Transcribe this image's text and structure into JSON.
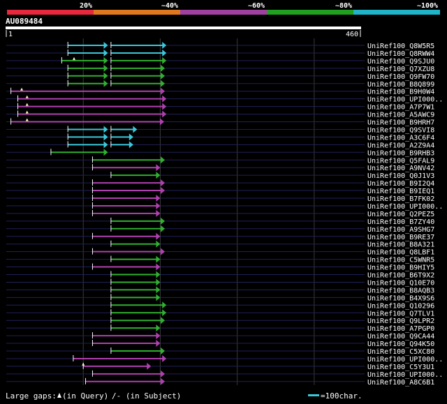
{
  "legend": {
    "labels": [
      "20%",
      "~40%",
      "~60%",
      "~80%",
      "~100%"
    ],
    "colors": [
      "#e8283c",
      "#e07820",
      "#a040a0",
      "#20a020",
      "#20b4c8"
    ]
  },
  "query": {
    "id": "AU089484",
    "start": "1",
    "end": "460",
    "length": 460
  },
  "series_colors": {
    "cyan": "#3cc8dc",
    "green": "#30b030",
    "purple": "#b040b0"
  },
  "hits": [
    {
      "id": "UniRef100_Q8W5R5",
      "color": "cyan",
      "segs": [
        [
          80,
          132
        ],
        [
          136,
          208
        ]
      ]
    },
    {
      "id": "UniRef100_Q8RWW4",
      "color": "cyan",
      "segs": [
        [
          80,
          132
        ],
        [
          136,
          208
        ]
      ]
    },
    {
      "id": "UniRef100_Q9SJU0",
      "color": "green",
      "segs": [
        [
          72,
          132
        ],
        [
          136,
          208
        ]
      ],
      "mark": 88
    },
    {
      "id": "UniRef100_Q7XZU8",
      "color": "green",
      "segs": [
        [
          80,
          132
        ],
        [
          136,
          206
        ]
      ]
    },
    {
      "id": "UniRef100_Q9FW70",
      "color": "green",
      "segs": [
        [
          80,
          132
        ],
        [
          136,
          206
        ]
      ]
    },
    {
      "id": "UniRef100_B8Q899",
      "color": "green",
      "segs": [
        [
          80,
          132
        ],
        [
          136,
          206
        ]
      ]
    },
    {
      "id": "UniRef100_B9H0W4",
      "color": "purple",
      "segs": [
        [
          6,
          206
        ]
      ],
      "mark": 20
    },
    {
      "id": "UniRef100_UPI000..",
      "color": "purple",
      "segs": [
        [
          15,
          208
        ]
      ],
      "mark": 27
    },
    {
      "id": "UniRef100_A7P7W1",
      "color": "purple",
      "segs": [
        [
          15,
          208
        ]
      ],
      "mark": 27
    },
    {
      "id": "UniRef100_A5AWC9",
      "color": "purple",
      "segs": [
        [
          15,
          208
        ]
      ],
      "mark": 27
    },
    {
      "id": "UniRef100_B9HRH7",
      "color": "purple",
      "segs": [
        [
          6,
          205
        ]
      ],
      "mark": 27
    },
    {
      "id": "UniRef100_Q9SVI8",
      "color": "cyan",
      "segs": [
        [
          80,
          132
        ],
        [
          136,
          170
        ]
      ]
    },
    {
      "id": "UniRef100_A3C6F4",
      "color": "cyan",
      "segs": [
        [
          80,
          132
        ],
        [
          136,
          165
        ]
      ]
    },
    {
      "id": "UniRef100_A2Z9A4",
      "color": "cyan",
      "segs": [
        [
          80,
          132
        ],
        [
          136,
          165
        ]
      ]
    },
    {
      "id": "UniRef100_B9RHB3",
      "color": "green",
      "segs": [
        [
          58,
          132
        ]
      ]
    },
    {
      "id": "UniRef100_Q5FAL9",
      "color": "green",
      "segs": [
        [
          112,
          206
        ]
      ]
    },
    {
      "id": "UniRef100_A9NV42",
      "color": "purple",
      "segs": [
        [
          112,
          200
        ]
      ]
    },
    {
      "id": "UniRef100_Q0J1V3",
      "color": "green",
      "segs": [
        [
          136,
          200
        ]
      ]
    },
    {
      "id": "UniRef100_B9I2Q4",
      "color": "purple",
      "segs": [
        [
          112,
          206
        ]
      ]
    },
    {
      "id": "UniRef100_B9IEQ1",
      "color": "purple",
      "segs": [
        [
          112,
          206
        ]
      ]
    },
    {
      "id": "UniRef100_B7FK02",
      "color": "purple",
      "segs": [
        [
          112,
          200
        ]
      ]
    },
    {
      "id": "UniRef100_UPI000..",
      "color": "purple",
      "segs": [
        [
          112,
          200
        ]
      ]
    },
    {
      "id": "UniRef100_Q2PEZ5",
      "color": "purple",
      "segs": [
        [
          112,
          200
        ]
      ]
    },
    {
      "id": "UniRef100_B7ZY40",
      "color": "green",
      "segs": [
        [
          136,
          206
        ]
      ]
    },
    {
      "id": "UniRef100_A9SHG7",
      "color": "green",
      "segs": [
        [
          136,
          206
        ]
      ]
    },
    {
      "id": "UniRef100_B9RE37",
      "color": "purple",
      "segs": [
        [
          112,
          200
        ]
      ]
    },
    {
      "id": "UniRef100_B8A321",
      "color": "green",
      "segs": [
        [
          136,
          200
        ]
      ]
    },
    {
      "id": "UniRef100_Q8LBF1",
      "color": "purple",
      "segs": [
        [
          112,
          206
        ]
      ]
    },
    {
      "id": "UniRef100_C5WNR5",
      "color": "green",
      "segs": [
        [
          136,
          200
        ]
      ]
    },
    {
      "id": "UniRef100_B9HIY5",
      "color": "purple",
      "segs": [
        [
          112,
          200
        ]
      ]
    },
    {
      "id": "UniRef100_B6T9X2",
      "color": "green",
      "segs": [
        [
          136,
          200
        ]
      ]
    },
    {
      "id": "UniRef100_Q10E70",
      "color": "green",
      "segs": [
        [
          136,
          200
        ]
      ]
    },
    {
      "id": "UniRef100_B8AQB3",
      "color": "green",
      "segs": [
        [
          136,
          200
        ]
      ]
    },
    {
      "id": "UniRef100_B4X9S6",
      "color": "green",
      "segs": [
        [
          136,
          200
        ]
      ]
    },
    {
      "id": "UniRef100_Q10296",
      "color": "green",
      "segs": [
        [
          136,
          208
        ]
      ]
    },
    {
      "id": "UniRef100_Q7TLV1",
      "color": "green",
      "segs": [
        [
          136,
          208
        ]
      ]
    },
    {
      "id": "UniRef100_Q9LPR2",
      "color": "green",
      "segs": [
        [
          136,
          206
        ]
      ]
    },
    {
      "id": "UniRef100_A7PGP0",
      "color": "green",
      "segs": [
        [
          136,
          200
        ]
      ]
    },
    {
      "id": "UniRef100_Q9CA44",
      "color": "purple",
      "segs": [
        [
          112,
          200
        ]
      ]
    },
    {
      "id": "UniRef100_Q94K50",
      "color": "purple",
      "segs": [
        [
          112,
          200
        ]
      ]
    },
    {
      "id": "UniRef100_C5XC80",
      "color": "green",
      "segs": [
        [
          136,
          206
        ]
      ]
    },
    {
      "id": "UniRef100_UPI000..",
      "color": "purple",
      "segs": [
        [
          87,
          208
        ]
      ]
    },
    {
      "id": "UniRef100_C5Y3U1",
      "color": "purple",
      "segs": [
        [
          100,
          188
        ]
      ],
      "mark": 100
    },
    {
      "id": "UniRef100_UPI000..",
      "color": "purple",
      "segs": [
        [
          112,
          206
        ]
      ]
    },
    {
      "id": "UniRef100_A8C6B1",
      "color": "purple",
      "segs": [
        [
          103,
          206
        ]
      ]
    }
  ],
  "footer": {
    "gaps_label": "Large gaps:",
    "query_gap": "(in Query)",
    "subject_gap": "/- (in Subject)",
    "scale_label": "=100char."
  }
}
